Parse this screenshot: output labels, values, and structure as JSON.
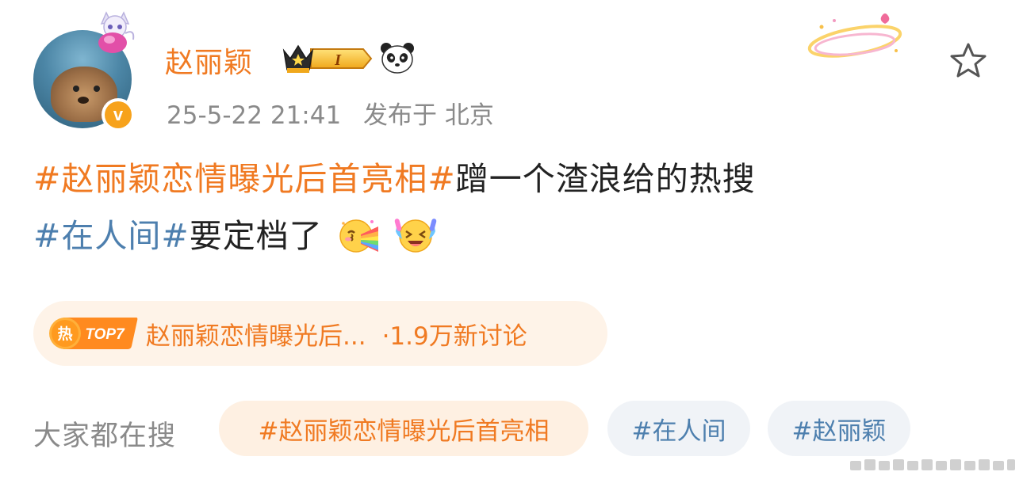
{
  "post": {
    "author": {
      "name": "赵丽颖",
      "verified_symbol": "v",
      "vip_level": "I"
    },
    "meta": {
      "time": "25-5-22 21:41",
      "location": "发布于 北京"
    },
    "content": {
      "topic1": "#赵丽颖恋情曝光后首亮相#",
      "text1": "蹭一个渣浪给的热搜",
      "topic2": "#在人间#",
      "text2": "要定档了"
    }
  },
  "hot": {
    "badge_char": "热",
    "rank": "TOP7",
    "title": "赵丽颖恋情曝光后...",
    "count": "·1.9万新讨论"
  },
  "search": {
    "label": "大家都在搜",
    "chips": [
      "#赵丽颖恋情曝光后首亮相",
      "#在人间",
      "#赵丽颖"
    ]
  },
  "colors": {
    "accent_orange": "#f07a22",
    "topic_blue": "#4d7fae",
    "meta_gray": "#8a8a8a"
  },
  "icons": [
    "star-outline-icon",
    "panda-icon",
    "crown-badge-icon",
    "verified-icon",
    "kiss-rainbow-emoji",
    "laughing-emoji"
  ]
}
